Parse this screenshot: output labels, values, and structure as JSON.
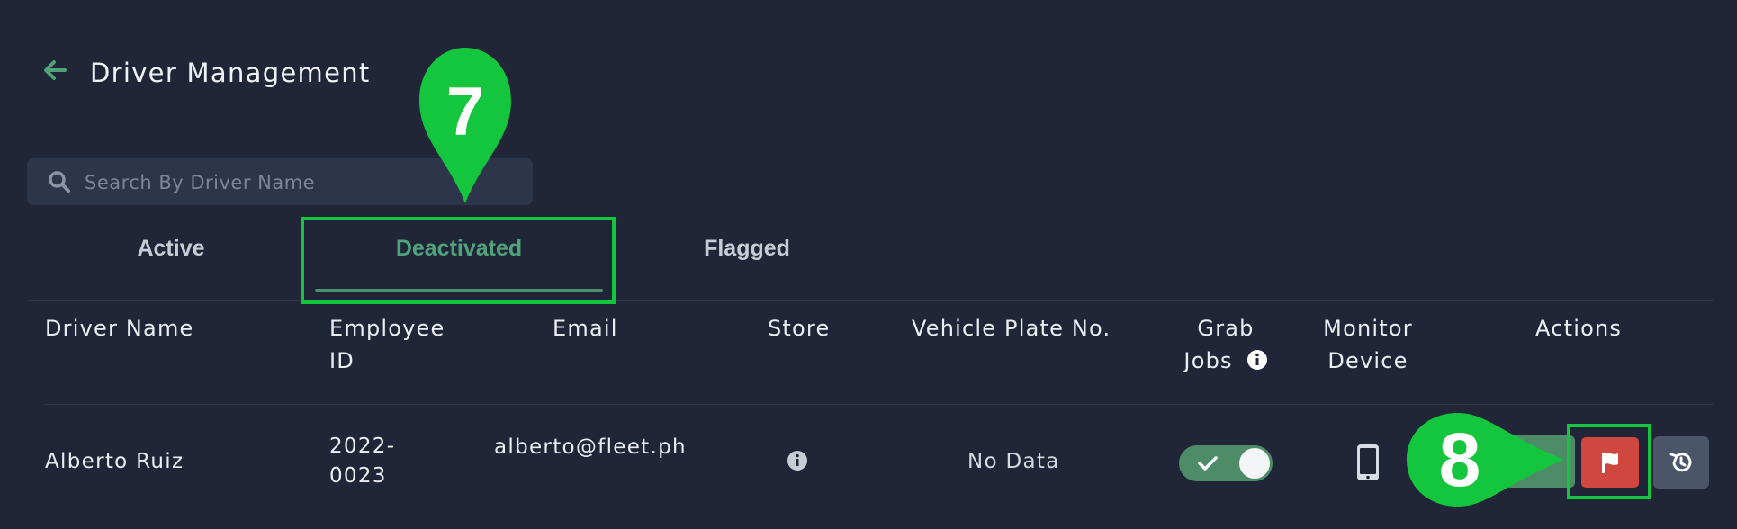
{
  "header": {
    "title": "Driver Management",
    "back_icon": "arrow-left-icon"
  },
  "search": {
    "placeholder": "Search By Driver Name"
  },
  "tabs": [
    {
      "label": "Active"
    },
    {
      "label": "Deactivated",
      "selected": true
    },
    {
      "label": "Flagged"
    }
  ],
  "table": {
    "headers": {
      "driver_name": "Driver Name",
      "employee_id_1": "Employee",
      "employee_id_2": "ID",
      "email": "Email",
      "store": "Store",
      "vehicle_plate": "Vehicle Plate No.",
      "grab_jobs_1": "Grab",
      "grab_jobs_2": "Jobs",
      "monitor_device_1": "Monitor",
      "monitor_device_2": "Device",
      "actions": "Actions"
    },
    "rows": [
      {
        "driver_name": "Alberto Ruiz",
        "employee_id_1": "2022-",
        "employee_id_2": "0023",
        "email": "alberto@fleet.ph",
        "store_icon": "info-icon",
        "vehicle_plate": "No Data",
        "grab_jobs_enabled": true,
        "monitor_device_icon": "mobile-phone-icon",
        "actions": [
          "reactivate",
          "flag",
          "history"
        ]
      }
    ]
  },
  "annotations": {
    "pin_a": "7",
    "pin_b": "8"
  },
  "colors": {
    "background": "#202637",
    "accent_green": "#4fa27a",
    "flag_red": "#d0473f",
    "annotation_green": "#13c63e"
  }
}
